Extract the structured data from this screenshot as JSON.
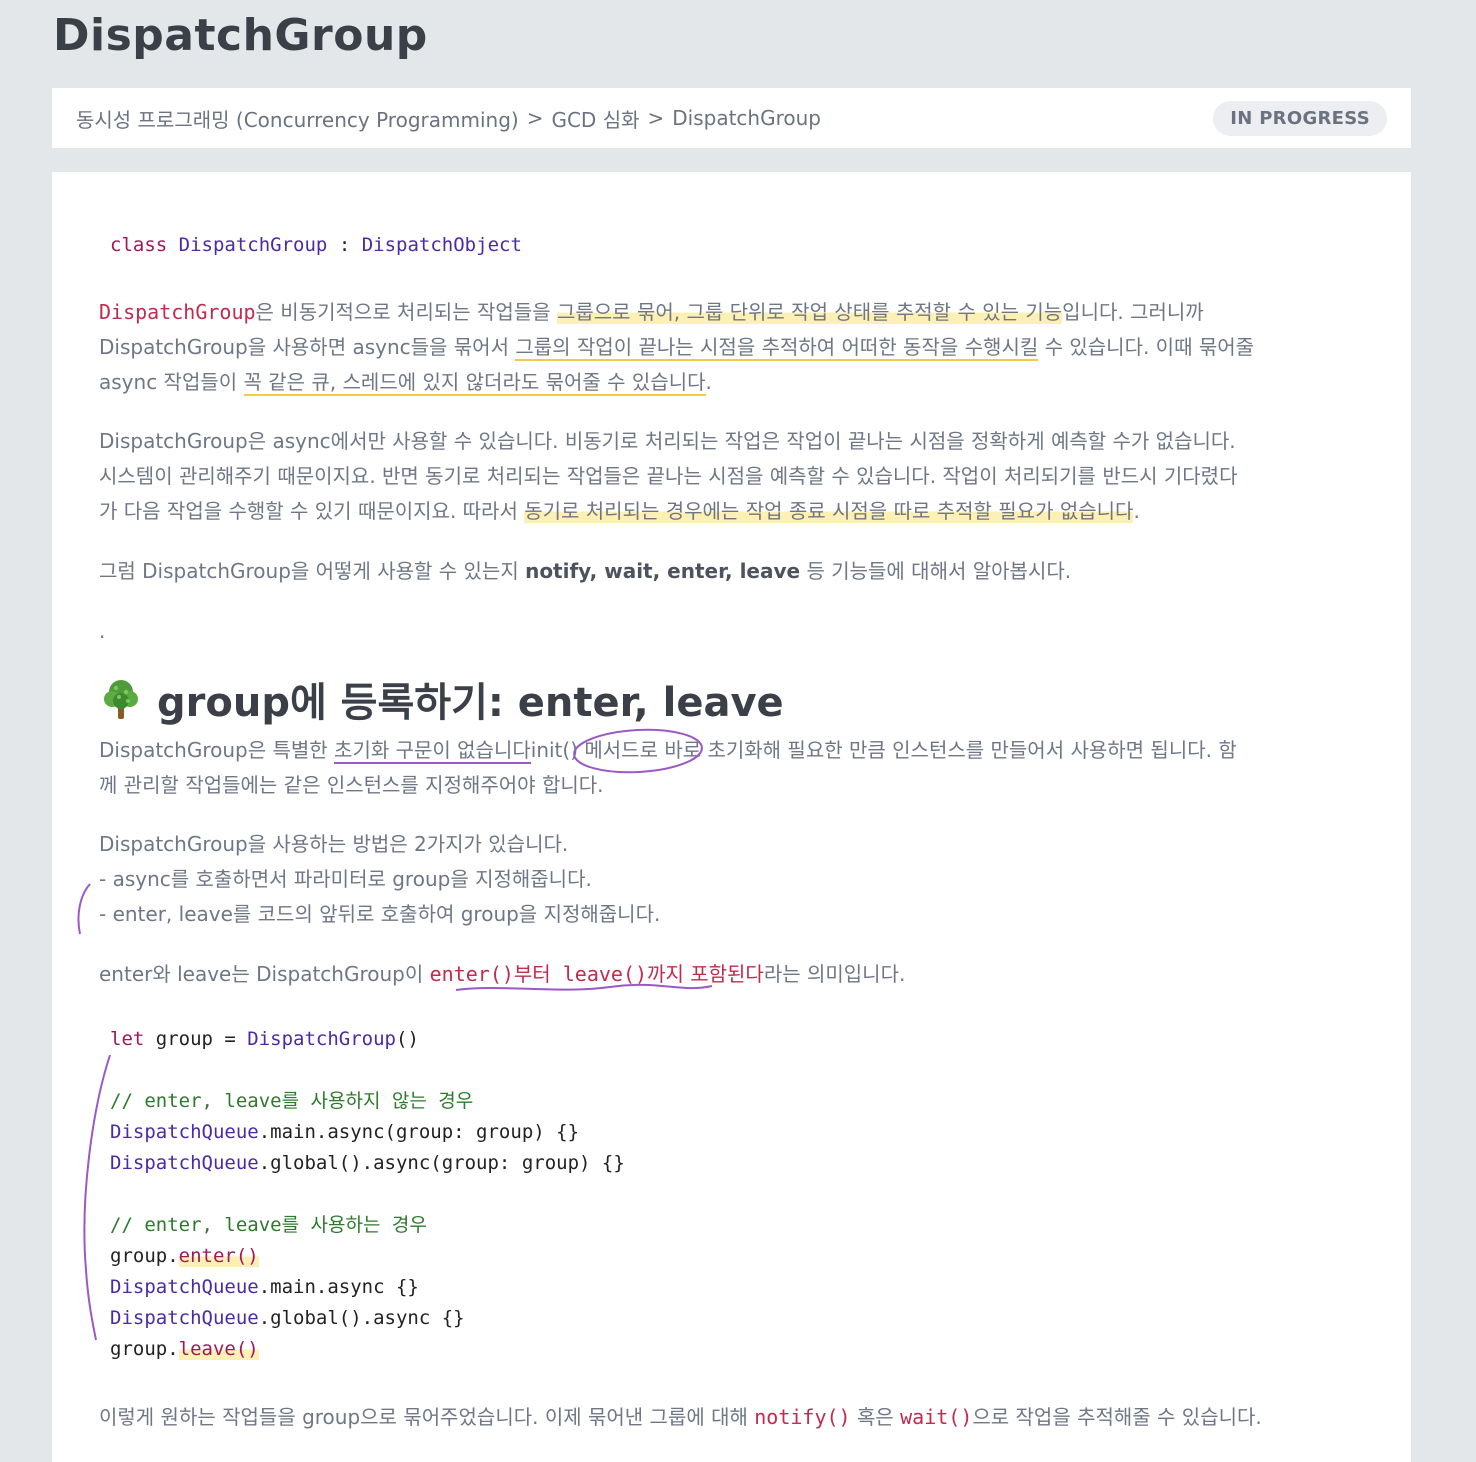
{
  "page": {
    "title": "DispatchGroup"
  },
  "breadcrumb": {
    "items": [
      "동시성 프로그래밍 (Concurrency Programming)",
      "GCD 심화",
      "DispatchGroup"
    ],
    "separator": ">"
  },
  "status": {
    "label": "IN PROGRESS"
  },
  "declaration": {
    "keyword": "class",
    "name": "DispatchGroup",
    "colon": ":",
    "parent": "DispatchObject"
  },
  "intro": {
    "code": "DispatchGroup",
    "t1": "은 비동기적으로 처리되는 작업들을 ",
    "h1": "그룹으로 묶어, 그룹 단위로 작업 상태를 추적할 수 있는 기능",
    "t2": "입니다. 그러니까",
    "line2_start": "DispatchGroup을 사용하면 async들을 묶어서 ",
    "u1": "그룹의 작업이 끝나는 시점을 추적하여 어떠한 동작을 수행시킬",
    "line2_end": " 수 있습니다. 이때 묶어줄",
    "line3_start": "async 작업들이 ",
    "u2": "꼭 같은 큐, 스레드에 있지 않더라도 묶어줄 수 있습니다",
    "line3_end": "."
  },
  "para2": {
    "line1": "DispatchGroup은 async에서만 사용할 수 있습니다. 비동기로 처리되는 작업은 작업이 끝나는 시점을 정확하게 예측할 수가 없습니다.",
    "line2": "시스템이 관리해주기 때문이지요. 반면 동기로 처리되는 작업들은 끝나는 시점을 예측할 수 있습니다. 작업이 처리되기를 반드시 기다렸다",
    "line3_start": "가 다음 작업을 수행할 수 있기 때문이지요. 따라서 ",
    "h": "동기로 처리되는 경우에는 작업 종료 시점을 따로 추적할 필요가 없습니다",
    "line3_end": "."
  },
  "para3": {
    "start": "그럼 DispatchGroup을 어떻게 사용할 수 있는지 ",
    "bold": "notify, wait, enter, leave",
    "end": " 등 기능들에 대해서 알아봅시다."
  },
  "dot": ".",
  "section": {
    "heading": "group에 등록하기: enter, leave",
    "icon": "tree-icon"
  },
  "para4": {
    "start": "DispatchGroup은 특별한 ",
    "u": "초기화 구문이 없습니다",
    "mid": "init() 메서드",
    "end": "로 바로 초기화해 필요한 만큼 인스턴스를 만들어서 사용하면 됩니다. 함",
    "line2": "께 관리할 작업들에는 같은 인스턴스를 지정해주어야 합니다."
  },
  "para5": {
    "line1": "DispatchGroup을 사용하는 방법은 2가지가 있습니다.",
    "line2": "- async를 호출하면서 파라미터로 group을 지정해줍니다.",
    "line3": "- enter, leave를 코드의 앞뒤로 호출하여 group을 지정해줍니다."
  },
  "para6": {
    "start": "enter와 leave는 DispatchGroup이 ",
    "c1": "enter()부터 leave()까지",
    "gap": " ",
    "c2": "포함된다",
    "end": "라는 의미입니다."
  },
  "code": {
    "let_kw": "let",
    "let_rest": " group = ",
    "let_type": "DispatchGroup",
    "let_end": "()",
    "comment1": "// enter, leave를 사용하지 않는 경우",
    "dq": "DispatchQueue",
    "l1_rest": ".main.async(group: group) {}",
    "l2_rest": ".global().async(group: group) {}",
    "comment2": "// enter, leave를 사용하는 경우",
    "group": "group.",
    "enter": "enter()",
    "l3_rest": ".main.async {}",
    "l4_rest": ".global().async {}",
    "leave": "leave()"
  },
  "para7": {
    "start": "이렇게 원하는 작업들을 group으로 묶어주었습니다. 이제 묶어낸 그룹에 대해 ",
    "c1": "notify()",
    "mid": " 혹은 ",
    "c2": "wait()",
    "end": "으로 작업을 추적해줄 수 있습니다."
  }
}
